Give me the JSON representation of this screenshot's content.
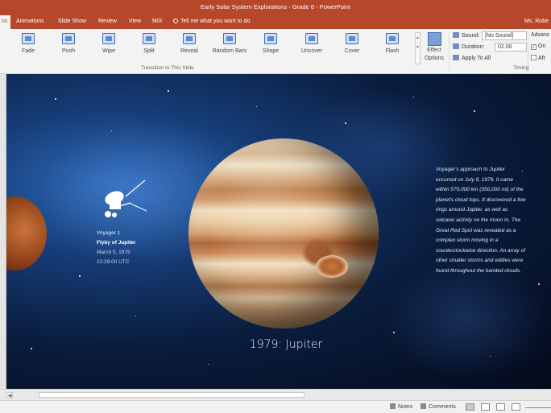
{
  "window": {
    "title": "Early Solar System Explorations - Grade 6 - PowerPoint",
    "user": "Ms. Robe"
  },
  "tabs": [
    {
      "label": "ns",
      "active": true
    },
    {
      "label": "Animations"
    },
    {
      "label": "Slide Show"
    },
    {
      "label": "Review"
    },
    {
      "label": "View"
    },
    {
      "label": "MIX"
    },
    {
      "label": "Tell me what you want to do",
      "icon": "lightbulb-icon"
    }
  ],
  "ribbon": {
    "transitions": [
      {
        "label": "Fade"
      },
      {
        "label": "Push"
      },
      {
        "label": "Wipe"
      },
      {
        "label": "Split"
      },
      {
        "label": "Reveal"
      },
      {
        "label": "Random Bars"
      },
      {
        "label": "Shape"
      },
      {
        "label": "Uncover"
      },
      {
        "label": "Cover"
      },
      {
        "label": "Flash"
      }
    ],
    "effect_options": {
      "line1": "Effect",
      "line2": "Options"
    },
    "group_transition": "Transition to This Slide",
    "group_timing": "Timing",
    "timing": {
      "sound_label": "Sound:",
      "sound_value": "[No Sound]",
      "duration_label": "Duration:",
      "duration_value": "02.00",
      "apply_all": "Apply To All"
    },
    "advance": {
      "label": "Advanc",
      "on_click": "On",
      "after": "Aft"
    }
  },
  "slide": {
    "probe_name": "Voyager 1",
    "probe_event": "Flyby of Jupiter",
    "probe_date": "March 5, 1979",
    "probe_time": "22:29:00 UTC",
    "caption": "1979: Jupiter",
    "description": "Voyager's approach to Jupiter occurred on July 9, 1979. It came within 570,000 km (350,000 mi) of the planet's cloud tops. It discovered a few rings around Jupiter, as well as volcanic activity on the moon Io. The Great Red Spot was revealed as a complex storm moving in a counterclockwise direction. An array of other smaller storms and eddies were found throughout the banded clouds."
  },
  "statusbar": {
    "notes": "Notes",
    "comments": "Comments"
  },
  "colors": {
    "accent": "#b7472a",
    "ribbon_bg": "#f3f3f3",
    "space_dark": "#040a1a"
  }
}
